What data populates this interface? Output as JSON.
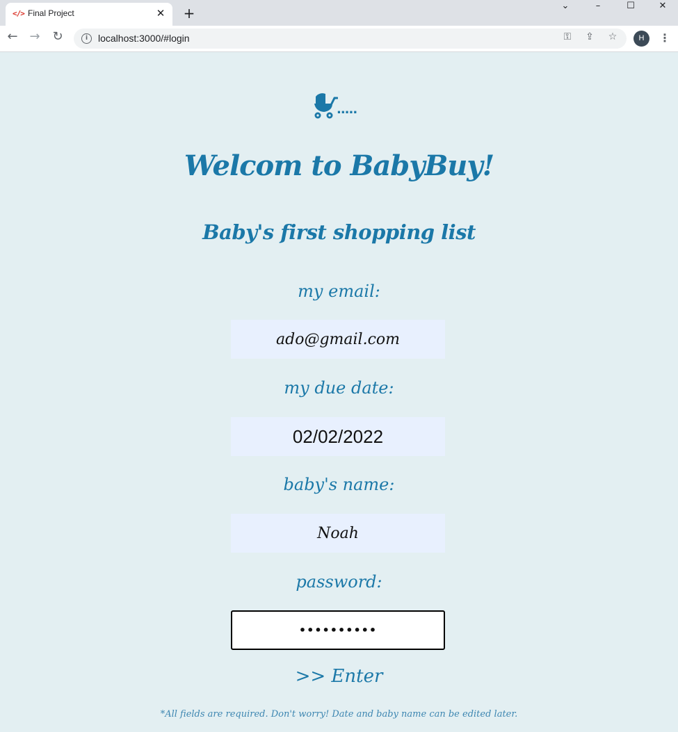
{
  "browser": {
    "tab_title": "Final Project",
    "tab_favicon": "</>",
    "url": "localhost:3000/#login",
    "profile_initial": "H",
    "window_controls": {
      "minimize": "–",
      "maximize": "☐",
      "close": "✕",
      "tab_search": "⌄"
    }
  },
  "page": {
    "logo_icon": "baby-carriage-icon",
    "logo_trail": ".....",
    "title": "Welcom to BabyBuy!",
    "subtitle": "Baby's first shopping list",
    "form": {
      "email_label": "my email:",
      "email_value": "ado@gmail.com",
      "due_date_label": "my due date:",
      "due_date_value": "02/02/2022",
      "baby_name_label": "baby's name:",
      "baby_name_value": "Noah",
      "password_label": "password:",
      "password_value": "••••••••••",
      "submit_label": ">> Enter"
    },
    "note": "*All fields are required. Don't worry! Date and baby name can be edited later."
  },
  "colors": {
    "accent": "#1b78a8",
    "page_bg": "#e3eff2",
    "field_bg": "#e8f0fe"
  }
}
